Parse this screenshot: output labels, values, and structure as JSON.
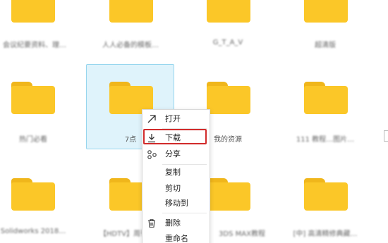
{
  "files": [
    {
      "id": "r0c0",
      "name": "会议纪要资料、理…",
      "blurred": true
    },
    {
      "id": "r0c1",
      "name": "人人必备的模板…",
      "blurred": true
    },
    {
      "id": "r0c2",
      "name": "G_T_A_V",
      "blurred": true
    },
    {
      "id": "r0c3",
      "name": "超清版",
      "blurred": true
    },
    {
      "id": "r1c0",
      "name": "热门必看",
      "blurred": true
    },
    {
      "id": "r1c1",
      "name": "7点",
      "blurred": false
    },
    {
      "id": "r1c2",
      "name": "我的资源",
      "blurred": false
    },
    {
      "id": "r1c3",
      "name": "111 教程…图片…",
      "blurred": true
    },
    {
      "id": "r2c0",
      "name": "Solidworks 2018…",
      "blurred": true
    },
    {
      "id": "r2c1",
      "name": "【HDTV】周刊秘…",
      "blurred": true
    },
    {
      "id": "r2c2",
      "name": "3DS MAX教程",
      "blurred": true
    },
    {
      "id": "r2c3",
      "name": "[中] 高清精修典藏…",
      "blurred": true
    }
  ],
  "context_menu": {
    "items": [
      {
        "label": "打开",
        "icon": "open-arrow-icon"
      },
      {
        "label": "下载",
        "icon": "download-icon"
      },
      {
        "label": "分享",
        "icon": "share-icon"
      },
      {
        "label": "复制",
        "icon": ""
      },
      {
        "label": "剪切",
        "icon": ""
      },
      {
        "label": "移动到",
        "icon": ""
      },
      {
        "label": "删除",
        "icon": "trash-icon"
      },
      {
        "label": "重命名",
        "icon": ""
      }
    ]
  },
  "colors": {
    "folder_body": "#fbc728",
    "folder_tab": "#f0b61b",
    "selection_bg": "#dff3fb",
    "selection_border": "#97d6ee",
    "highlight": "#d12b2b"
  }
}
